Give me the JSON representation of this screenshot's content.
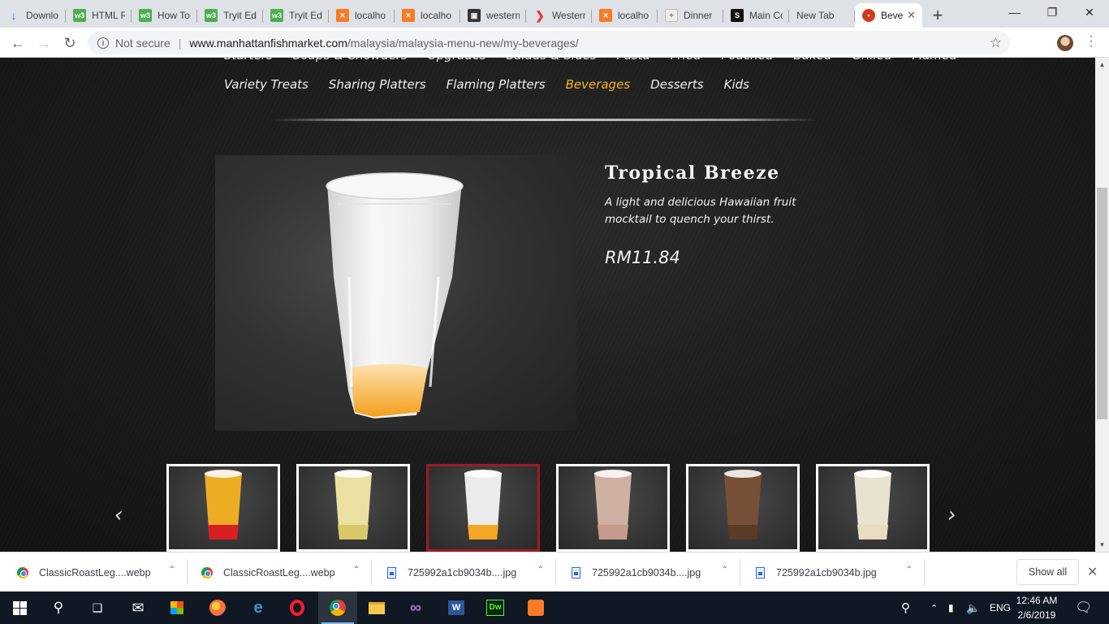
{
  "browser": {
    "tabs": [
      {
        "title": "Downlo",
        "icon": "download-icon",
        "active": false
      },
      {
        "title": "HTML R",
        "icon": "w3schools-icon",
        "active": false
      },
      {
        "title": "How To",
        "icon": "w3schools-icon",
        "active": false
      },
      {
        "title": "Tryit Ed",
        "icon": "w3schools-icon",
        "active": false
      },
      {
        "title": "Tryit Ed",
        "icon": "w3schools-icon",
        "active": false
      },
      {
        "title": "localho",
        "icon": "xampp-icon",
        "active": false
      },
      {
        "title": "localho",
        "icon": "xampp-icon",
        "active": false
      },
      {
        "title": "western",
        "icon": "dark-site-icon",
        "active": false
      },
      {
        "title": "Westerr",
        "icon": "western-icon",
        "active": false
      },
      {
        "title": "localho",
        "icon": "xampp-icon",
        "active": false
      },
      {
        "title": "Dinner",
        "icon": "dinner-icon",
        "active": false
      },
      {
        "title": "Main Co",
        "icon": "main-icon",
        "active": false
      },
      {
        "title": "New Tab",
        "icon": "",
        "active": false
      },
      {
        "title": "Beve",
        "icon": "fishmarket-icon",
        "active": true
      }
    ],
    "new_tab_label": "+",
    "security_label": "Not secure",
    "url_host": "www.manhattanfishmarket.com",
    "url_path": "/malaysia/malaysia-menu-new/my-beverages/"
  },
  "page": {
    "menu_row1": [
      "Starters",
      "Soups & Chowders",
      "Upgrades",
      "Salads & Sides",
      "Pasta",
      "Fried",
      "Poached",
      "Baked",
      "Grilled",
      "Flamed"
    ],
    "menu_row2": [
      "Variety Treats",
      "Sharing Platters",
      "Flaming Platters",
      "Beverages",
      "Desserts",
      "Kids"
    ],
    "current_menu": "Beverages",
    "product": {
      "title": "Tropical Breeze",
      "description": "A light and delicious Hawaiian fruit mocktail to quench your thirst.",
      "price": "RM11.84"
    },
    "carousel": {
      "prev_label": "‹",
      "next_label": "›",
      "selected_index": 2,
      "thumbs": [
        {
          "icon": "sunrise-mocktail-icon",
          "liquid": "#f5b324",
          "bottom": "#d81f26"
        },
        {
          "icon": "lemon-drink-icon",
          "liquid": "#f3e9a6",
          "bottom": "#d9c86a"
        },
        {
          "icon": "tropical-breeze-icon",
          "liquid": "#f4f4f4",
          "bottom": "#f5a623"
        },
        {
          "icon": "strawberry-shake-icon",
          "liquid": "#d8b6a8",
          "bottom": "#c79b8b"
        },
        {
          "icon": "chocolate-shake-icon",
          "liquid": "#7a5138",
          "bottom": "#5b3a26"
        },
        {
          "icon": "vanilla-shake-icon",
          "liquid": "#f1ecd9",
          "bottom": "#e6dcc0"
        }
      ]
    }
  },
  "downloads": {
    "items": [
      {
        "name": "ClassicRoastLeg....webp",
        "type": "chrome"
      },
      {
        "name": "ClassicRoastLeg....webp",
        "type": "chrome"
      },
      {
        "name": "725992a1cb9034b....jpg",
        "type": "image"
      },
      {
        "name": "725992a1cb9034b....jpg",
        "type": "image"
      },
      {
        "name": "725992a1cb9034b.jpg",
        "type": "image"
      }
    ],
    "show_all_label": "Show all"
  },
  "taskbar": {
    "language": "ENG",
    "time": "12:46 AM",
    "date": "2/6/2019"
  },
  "colors": {
    "accent_current_menu": "#f5b324",
    "selected_thumb_border": "#9b1c24"
  }
}
